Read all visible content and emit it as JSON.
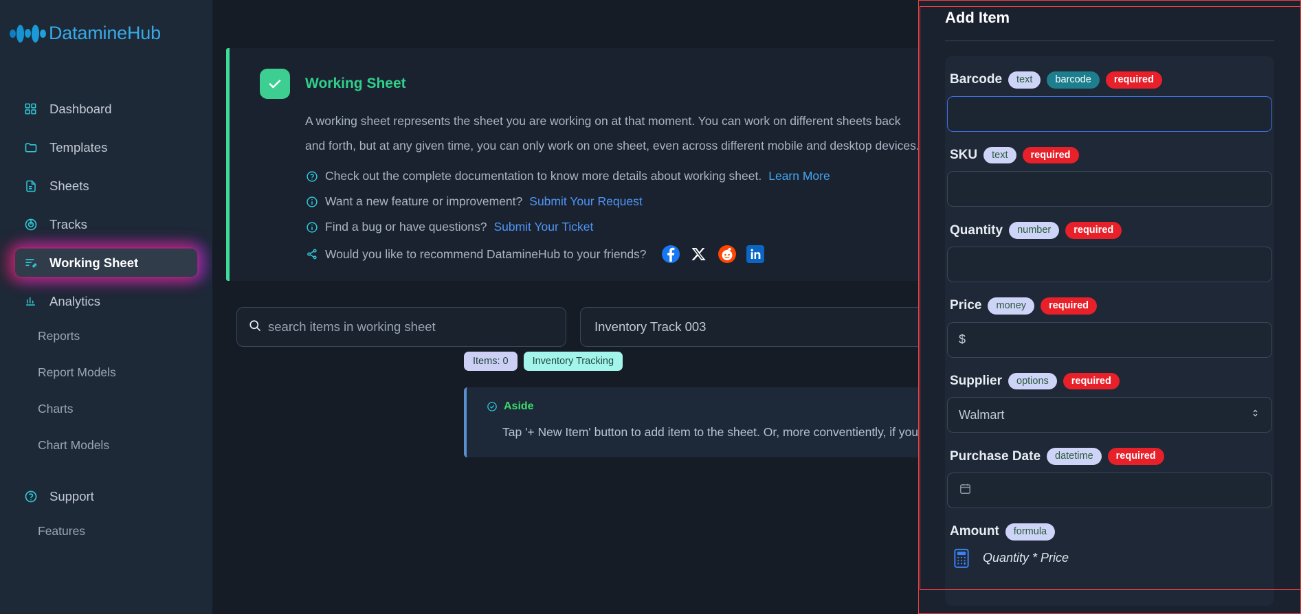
{
  "brand": {
    "name": "DatamineHub",
    "logo_icon": "logo-dots-icon"
  },
  "sidebar": {
    "items": [
      {
        "label": "Dashboard",
        "icon": "grid-icon",
        "active": false
      },
      {
        "label": "Templates",
        "icon": "folder-icon",
        "active": false
      },
      {
        "label": "Sheets",
        "icon": "document-icon",
        "active": false
      },
      {
        "label": "Tracks",
        "icon": "target-icon",
        "active": false
      },
      {
        "label": "Working Sheet",
        "icon": "edit-list-icon",
        "active": true
      },
      {
        "label": "Analytics",
        "icon": "bar-chart-icon",
        "active": false
      }
    ],
    "sub_items": [
      {
        "label": "Reports"
      },
      {
        "label": "Report Models"
      },
      {
        "label": "Charts"
      },
      {
        "label": "Chart Models"
      }
    ],
    "support": {
      "label": "Support",
      "icon": "question-circle-icon"
    },
    "features": {
      "label": "Features"
    }
  },
  "info_card": {
    "title": "Working Sheet",
    "check_icon": "check-icon",
    "paragraph_line1": "A working sheet represents the sheet you are working on at that moment. You can work on different sheets back",
    "paragraph_line2": "and forth, but at any given time, you can only work on one sheet, even across different mobile and desktop devices.",
    "doc_line": "Check out the complete documentation to know more details about working sheet.",
    "doc_link": "Learn More",
    "feature_line": "Want a new feature or improvement?",
    "feature_link": "Submit Your Request",
    "bug_line": "Find a bug or have questions?",
    "bug_link": "Submit Your Ticket",
    "share_line": "Would you like to recommend DatamineHub to your friends?",
    "socials": [
      {
        "name": "facebook-icon",
        "glyph": "f"
      },
      {
        "name": "x-twitter-icon",
        "glyph": "X"
      },
      {
        "name": "reddit-icon",
        "glyph": "r"
      },
      {
        "name": "linkedin-icon",
        "glyph": "in"
      }
    ]
  },
  "toolbar": {
    "search_placeholder": "search items in working sheet",
    "search_value": "",
    "search_icon": "search-icon",
    "track_name": "Inventory Track 003",
    "collapse_icon": "chevron-left-icon",
    "badges": [
      {
        "label": "Items: 0",
        "kind": "items"
      },
      {
        "label": "Inventory Tracking",
        "kind": "track"
      }
    ]
  },
  "aside": {
    "icon": "check-circle-icon",
    "title": "Aside",
    "text": "Tap '+ New Item' button to add item to the sheet. Or, more conventiently, if you have the data file, upload it."
  },
  "modal": {
    "title": "Add Item",
    "fields": [
      {
        "label": "Barcode",
        "pills": [
          {
            "text": "text",
            "kind": "type"
          },
          {
            "text": "barcode",
            "kind": "barcode"
          },
          {
            "text": "required",
            "kind": "req"
          }
        ],
        "input_type": "text",
        "value": "",
        "focused": true
      },
      {
        "label": "SKU",
        "pills": [
          {
            "text": "text",
            "kind": "type"
          },
          {
            "text": "required",
            "kind": "req"
          }
        ],
        "input_type": "text",
        "value": "",
        "focused": false
      },
      {
        "label": "Quantity",
        "pills": [
          {
            "text": "number",
            "kind": "type"
          },
          {
            "text": "required",
            "kind": "req"
          }
        ],
        "input_type": "number",
        "value": "",
        "focused": false
      },
      {
        "label": "Price",
        "pills": [
          {
            "text": "money",
            "kind": "type"
          },
          {
            "text": "required",
            "kind": "req"
          }
        ],
        "input_type": "money",
        "value": "$",
        "focused": false
      },
      {
        "label": "Supplier",
        "pills": [
          {
            "text": "options",
            "kind": "type"
          },
          {
            "text": "required",
            "kind": "req"
          }
        ],
        "input_type": "select",
        "value": "Walmart",
        "focused": false
      },
      {
        "label": "Purchase Date",
        "pills": [
          {
            "text": "datetime",
            "kind": "type"
          },
          {
            "text": "required",
            "kind": "req"
          }
        ],
        "input_type": "datetime",
        "value": "",
        "focused": false
      },
      {
        "label": "Amount",
        "pills": [
          {
            "text": "formula",
            "kind": "type"
          }
        ],
        "input_type": "formula",
        "value": "Quantity * Price",
        "focused": false
      }
    ]
  },
  "colors": {
    "accent_green": "#3ddc97",
    "brand_blue": "#38a9e8",
    "required_red": "#e8202a",
    "barcode_teal": "#1d7f8e",
    "modal_border": "#f04040",
    "link_blue": "#4f95f5"
  }
}
